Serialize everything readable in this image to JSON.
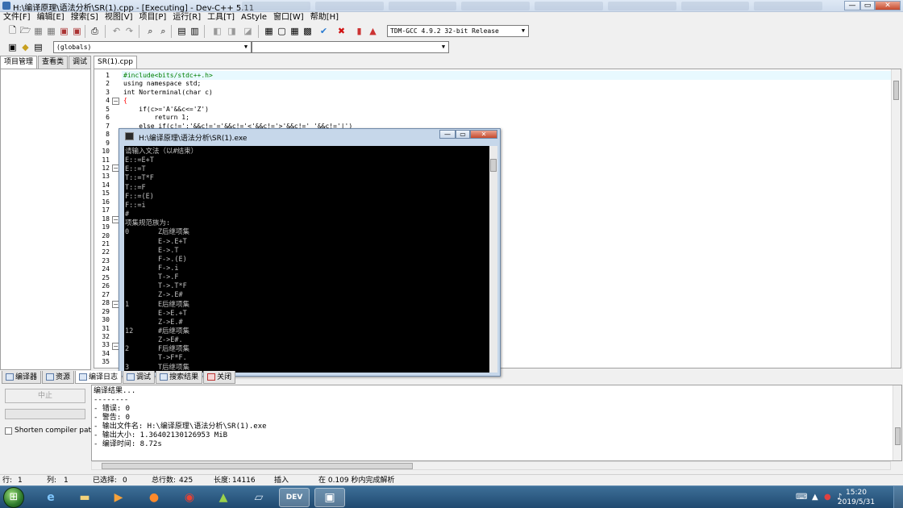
{
  "window": {
    "title": "H:\\编译原理\\语法分析\\SR(1).cpp - [Executing] - Dev-C++ 5.11",
    "minimize": "—",
    "maximize": "▭",
    "close": "✕"
  },
  "menu": [
    "文件[F]",
    "编辑[E]",
    "搜索[S]",
    "视图[V]",
    "项目[P]",
    "运行[R]",
    "工具[T]",
    "AStyle",
    "窗口[W]",
    "帮助[H]"
  ],
  "toolbar": {
    "compiler": "TDM-GCC 4.9.2 32-bit Release",
    "scope": "(globals)",
    "symbol": ""
  },
  "left_tabs": [
    "项目管理",
    "查看类",
    "调试"
  ],
  "editor": {
    "file_tab": "SR(1).cpp",
    "line_numbers": [
      "1",
      "2",
      "3",
      "4",
      "5",
      "6",
      "7",
      "8",
      "9",
      "10",
      "11",
      "12",
      "13",
      "14",
      "15",
      "16",
      "17",
      "18",
      "19",
      "20",
      "21",
      "22",
      "23",
      "24",
      "25",
      "26",
      "27",
      "28",
      "29",
      "30",
      "31",
      "32",
      "33",
      "34",
      "35"
    ],
    "code": [
      {
        "text": "#include<bits/stdc++.h>",
        "color": "#008000"
      },
      {
        "text": "using namespace std;",
        "color": "#000000"
      },
      {
        "text": "int Norterminal(char c)",
        "color": "#000000"
      },
      {
        "text": "{",
        "color": "#ff0000"
      },
      {
        "text": "    if(c>='A'&&c<='Z')",
        "color": "#000000"
      },
      {
        "text": "        return 1;",
        "color": "#000000"
      },
      {
        "text": "    else if(c!=':'&&c!='='&&c!='<'&&c!='>'&&c!=' '&&c!='|')",
        "color": "#000000"
      }
    ]
  },
  "console": {
    "title": "H:\\编译原理\\语法分析\\SR(1).exe",
    "lines": [
      "请输入文法（以#结束）",
      "E::=E+T",
      "E::=T",
      "T::=T*F",
      "T::=F",
      "F::=(E)",
      "F::=i",
      "#",
      "项集规范族为:",
      "0       Z后继项集",
      "        E->.E+T",
      "        E->.T",
      "        F->.(E)",
      "        F->.i",
      "        T->.F",
      "        T->.T*F",
      "        Z->.E#",
      "1       E后继项集",
      "        E->E.+T",
      "        Z->E.#",
      "12      #后继项集",
      "        Z->E#.",
      "2       F后继项集",
      "        T->F*F.",
      "3       T后继项集"
    ]
  },
  "bottom_tabs": [
    "编译器",
    "资源",
    "编译日志",
    "调试",
    "搜索结果",
    "关闭"
  ],
  "compile": {
    "abort": "中止",
    "shorten_label": "Shorten compiler paths",
    "log": [
      "编译结果...",
      "--------",
      "- 错误: 0",
      "- 警告: 0",
      "- 输出文件名: H:\\编译原理\\语法分析\\SR(1).exe",
      "- 输出大小: 1.36402130126953 MiB",
      "- 编译时间: 8.72s"
    ]
  },
  "status": {
    "row_label": "行:",
    "row": "1",
    "col_label": "列:",
    "col": "1",
    "sel_label": "已选择:",
    "sel": "0",
    "total_label": "总行数:",
    "total": "425",
    "len_label": "长度:",
    "len": "14116",
    "mode": "插入",
    "parse": "在 0.109 秒内完成解析"
  },
  "taskbar": {
    "time": "15:20",
    "date": "2019/5/31"
  }
}
